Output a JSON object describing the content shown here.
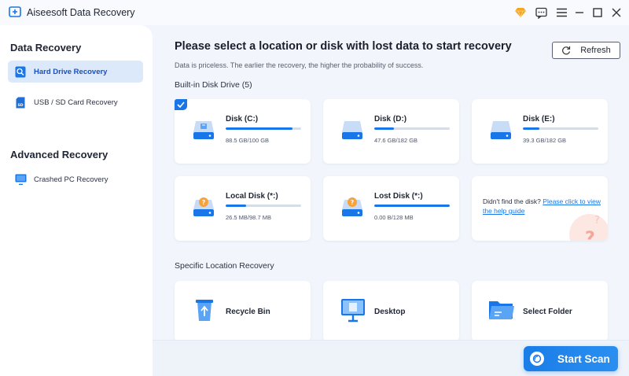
{
  "app": {
    "title": "Aiseesoft Data Recovery"
  },
  "sidebar": {
    "section1": "Data Recovery",
    "items1": [
      {
        "label": "Hard Drive Recovery",
        "active": true
      },
      {
        "label": "USB / SD Card Recovery",
        "active": false
      }
    ],
    "section2": "Advanced Recovery",
    "items2": [
      {
        "label": "Crashed PC Recovery",
        "active": false
      }
    ]
  },
  "main": {
    "title": "Please select a location or disk with lost data to start recovery",
    "subtitle": "Data is priceless. The earlier the recovery, the higher the probability of success.",
    "refresh_label": "Refresh",
    "builtin_label": "Built-in Disk Drive (5)",
    "disks": [
      {
        "name": "Disk (C:)",
        "size": "88.5 GB/100 GB",
        "used_fraction": 0.885,
        "selected": true,
        "icon": "hard-disk-icon"
      },
      {
        "name": "Disk (D:)",
        "size": "47.6 GB/182 GB",
        "used_fraction": 0.26,
        "selected": false,
        "icon": "hard-disk-icon"
      },
      {
        "name": "Disk (E:)",
        "size": "39.3 GB/182 GB",
        "used_fraction": 0.22,
        "selected": false,
        "icon": "hard-disk-icon"
      },
      {
        "name": "Local Disk (*:)",
        "size": "26.5 MB/98.7 MB",
        "used_fraction": 0.27,
        "selected": false,
        "icon": "unknown-disk-icon"
      },
      {
        "name": "Lost Disk (*:)",
        "size": "0.00 B/128 MB",
        "used_fraction": 1.0,
        "selected": false,
        "icon": "unknown-disk-icon"
      }
    ],
    "help": {
      "text": "Didn't find the disk?",
      "link": "Please click to view the help guide"
    },
    "specific_label": "Specific Location Recovery",
    "locations": [
      {
        "name": "Recycle Bin",
        "icon": "recycle-bin-icon"
      },
      {
        "name": "Desktop",
        "icon": "desktop-icon"
      },
      {
        "name": "Select Folder",
        "icon": "folder-icon"
      }
    ],
    "start_label": "Start Scan"
  },
  "colors": {
    "accent": "#1876e8",
    "sidebar_active_bg": "#dce9fb",
    "background": "#f2f6fc"
  }
}
